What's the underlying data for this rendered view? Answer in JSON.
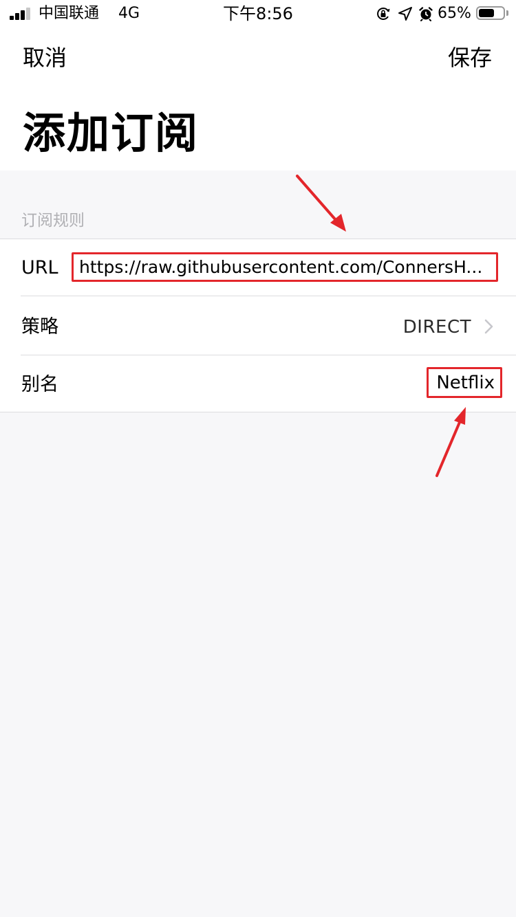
{
  "status_bar": {
    "carrier": "中国联通",
    "network": "4G",
    "time": "下午8:56",
    "battery_percent": "65%",
    "battery_level": 0.65,
    "icons": [
      "rotation-lock-icon",
      "location-arrow-icon",
      "alarm-clock-icon",
      "battery-icon"
    ]
  },
  "nav": {
    "cancel_label": "取消",
    "save_label": "保存",
    "title": "添加订阅"
  },
  "section": {
    "header": "订阅规则"
  },
  "form": {
    "url_label": "URL",
    "url_value": "https://raw.githubusercontent.com/ConnersH...",
    "policy_label": "策略",
    "policy_value": "DIRECT",
    "alias_label": "别名",
    "alias_value": "Netflix"
  },
  "annotations": {
    "highlight_color": "#e3262b"
  },
  "colors": {
    "background": "#f7f7f9",
    "surface": "#ffffff",
    "section_header": "#b0b0b4",
    "separator": "#dcdcdf"
  }
}
